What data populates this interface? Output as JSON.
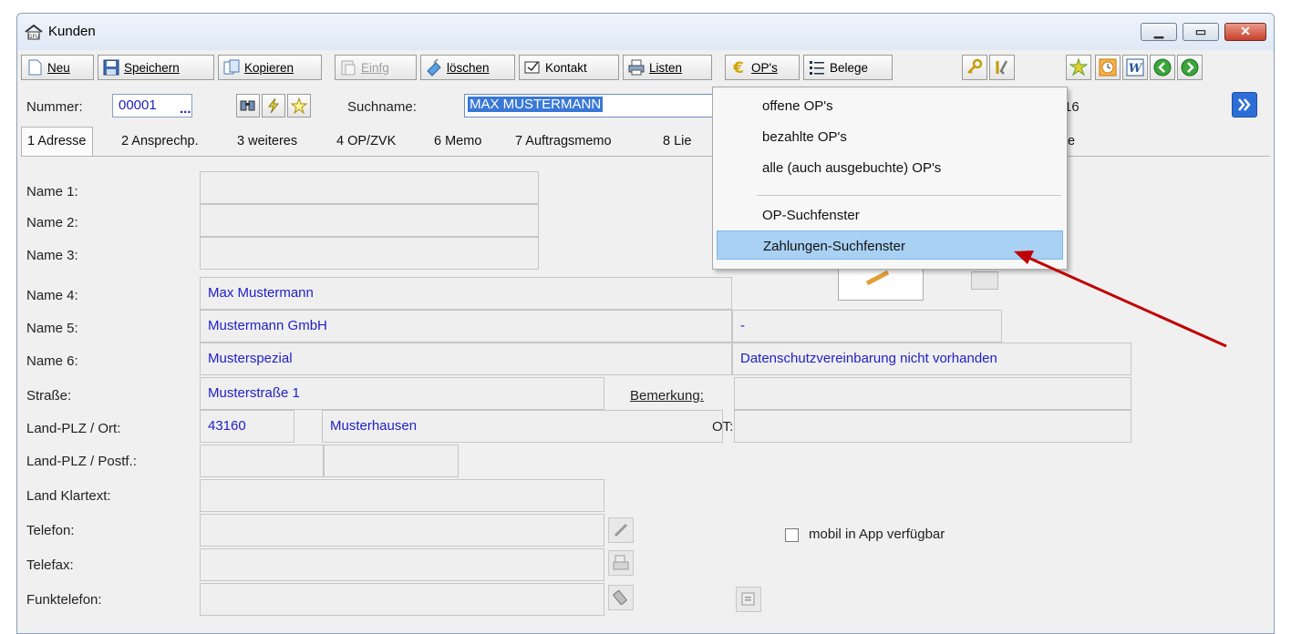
{
  "window": {
    "title": "Kunden",
    "app_badge": "GFU"
  },
  "toolbar": {
    "neu": "Neu",
    "speichern": "Speichern",
    "kopieren": "Kopieren",
    "einfg": "Einfg",
    "loeschen": "löschen",
    "kontakt": "Kontakt",
    "listen": "Listen",
    "ops": "OP's",
    "belege": "Belege"
  },
  "header": {
    "nummer_label": "Nummer:",
    "nummer_value": "00001",
    "nummer_more": "...",
    "suchname_label": "Suchname:",
    "suchname_value": "MAX MUSTERMANN",
    "partial_right": "16"
  },
  "tabs": [
    "1 Adresse",
    "2 Ansprechp.",
    "3 weiteres",
    "4 OP/ZVK",
    "6 Memo",
    "7 Auftragsmemo",
    "8 Lie",
    "e"
  ],
  "form": {
    "name1_label": "Name 1:",
    "name2_label": "Name 2:",
    "name3_label": "Name 3:",
    "name4_label": "Name 4:",
    "name4_value": "Max Mustermann",
    "name5_label": "Name 5:",
    "name5_value": "Mustermann GmbH",
    "name5_right": "-",
    "name6_label": "Name 6:",
    "name6_value": "Musterspezial",
    "name6_right": "Datenschutzvereinbarung nicht vorhanden",
    "strasse_label": "Straße:",
    "strasse_value": "Musterstraße 1",
    "bemerkung_label": "Bemerkung:",
    "landplz_label": "Land-PLZ / Ort:",
    "plz_value": "43160",
    "ort_value": "Musterhausen",
    "ot_label": "OT:",
    "postf_label": "Land-PLZ / Postf.:",
    "klartext_label": "Land Klartext:",
    "telefon_label": "Telefon:",
    "telefax_label": "Telefax:",
    "funk_label": "Funktelefon:",
    "mobil_label": "mobil in App verfügbar"
  },
  "dropdown": {
    "items": [
      "offene OP's",
      "bezahlte OP's",
      "alle (auch ausgebuchte) OP's",
      "OP-Suchfenster",
      "Zahlungen-Suchfenster"
    ]
  },
  "colors": {
    "highlight": "#a9d1f3",
    "field_text": "#2121c8",
    "annotation_arrow": "#c00000"
  }
}
